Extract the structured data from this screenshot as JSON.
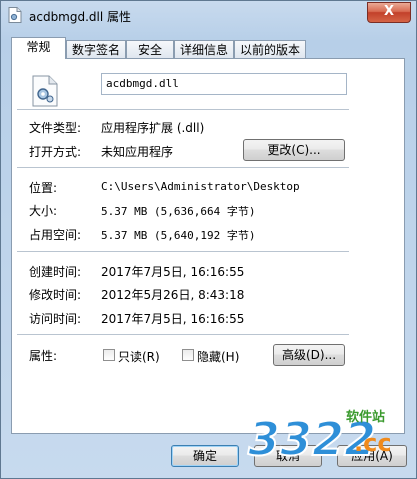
{
  "window": {
    "title": "acdbmgd.dll 属性",
    "close": "X"
  },
  "tabs": [
    "常规",
    "数字签名",
    "安全",
    "详细信息",
    "以前的版本"
  ],
  "file": {
    "name": "acdbmgd.dll"
  },
  "props": {
    "type_label": "文件类型:",
    "type_value": "应用程序扩展 (.dll)",
    "open_label": "打开方式:",
    "open_value": "未知应用程序",
    "change_button": "更改(C)...",
    "location_label": "位置:",
    "location_value": "C:\\Users\\Administrator\\Desktop",
    "size_label": "大小:",
    "size_value": "5.37 MB (5,636,664 字节)",
    "disk_label": "占用空间:",
    "disk_value": "5.37 MB (5,640,192 字节)",
    "created_label": "创建时间:",
    "created_value": "2017年7月5日, 16:16:55",
    "modified_label": "修改时间:",
    "modified_value": "2012年5月26日, 8:43:18",
    "accessed_label": "访问时间:",
    "accessed_value": "2017年7月5日, 16:16:55",
    "attr_label": "属性:",
    "readonly": "只读(R)",
    "hidden": "隐藏(H)",
    "advanced_button": "高级(D)..."
  },
  "footer": {
    "ok": "确定",
    "cancel": "取消",
    "apply": "应用(A)"
  },
  "watermark": {
    "brand": "3322",
    "domain": ".cc",
    "label": "软件站"
  }
}
